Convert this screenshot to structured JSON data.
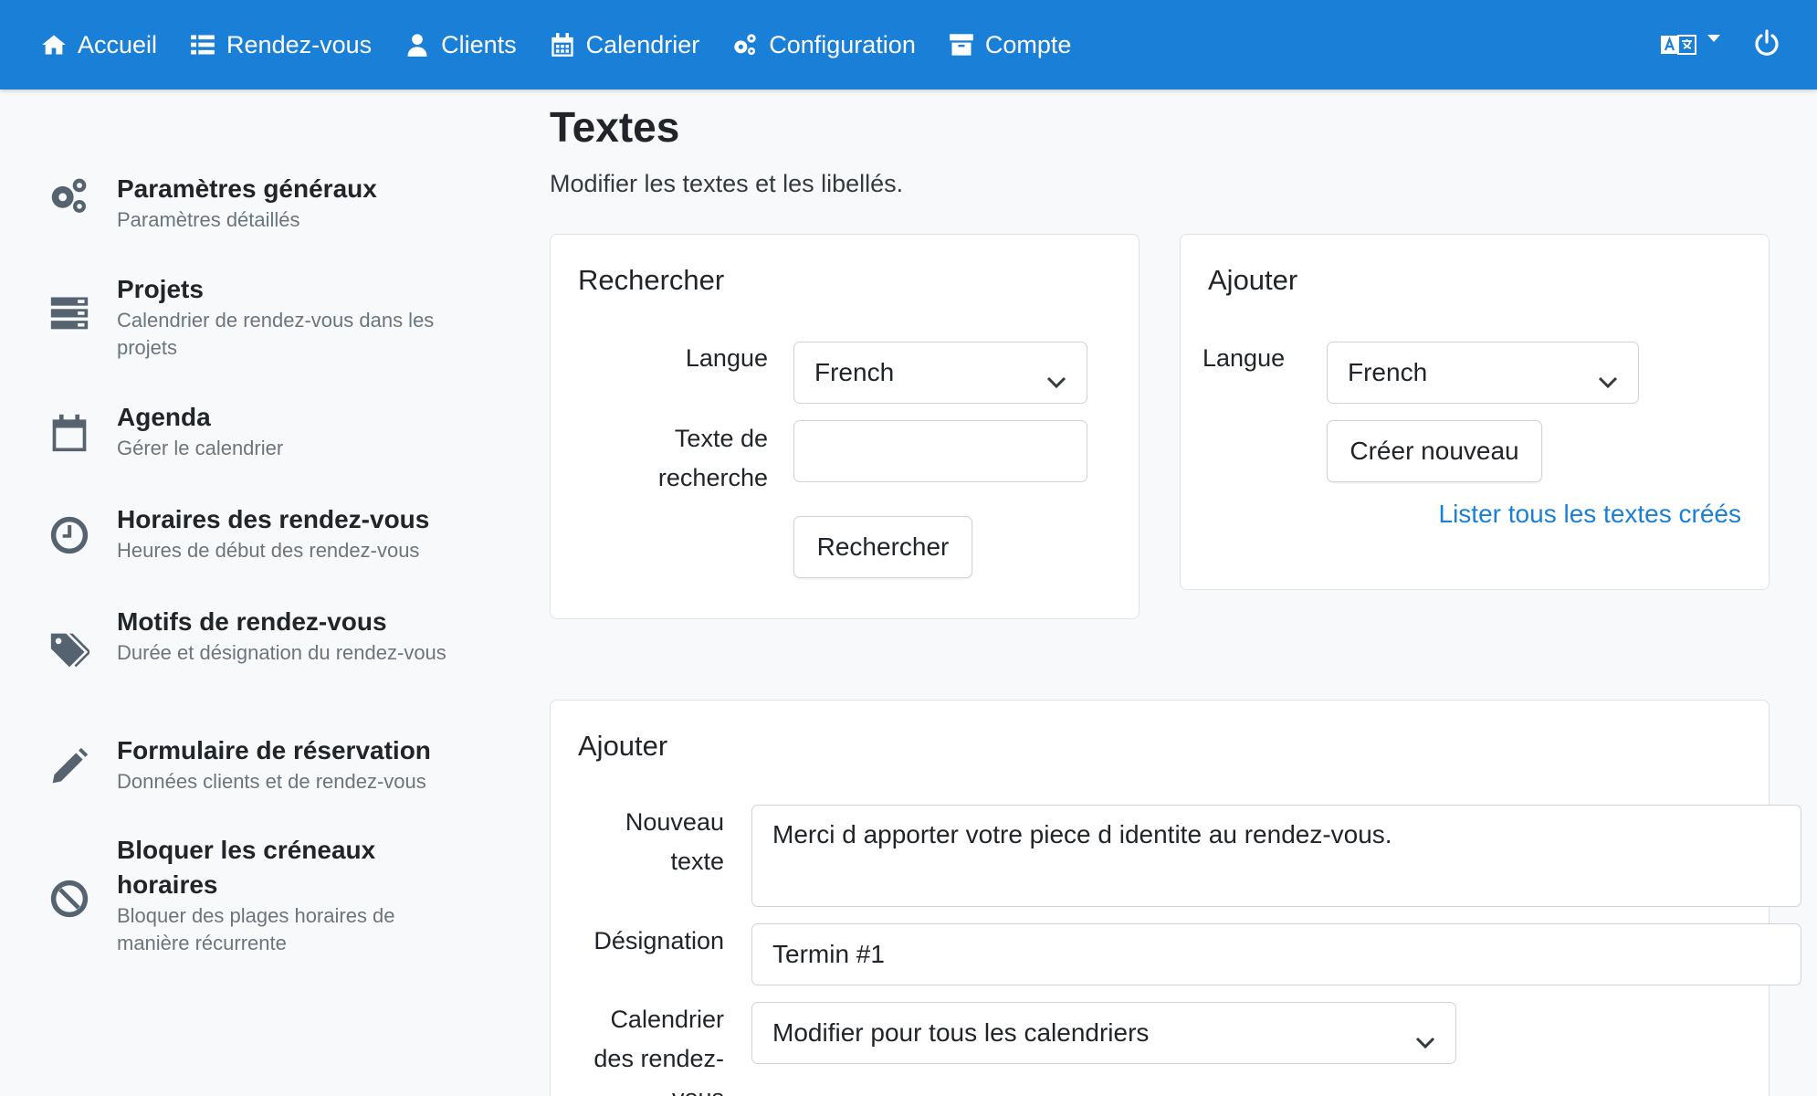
{
  "navbar": {
    "items": [
      {
        "label": "Accueil",
        "icon": "home-icon"
      },
      {
        "label": "Rendez-vous",
        "icon": "list-icon"
      },
      {
        "label": "Clients",
        "icon": "user-icon"
      },
      {
        "label": "Calendrier",
        "icon": "calendar-icon"
      },
      {
        "label": "Configuration",
        "icon": "cogs-icon"
      },
      {
        "label": "Compte",
        "icon": "archive-icon"
      }
    ],
    "right_icons": [
      "language-icon",
      "power-icon"
    ],
    "color": "#1a7fd6"
  },
  "sidebar": {
    "items": [
      {
        "title": "Paramètres généraux",
        "subtitle": "Paramètres détaillés",
        "icon": "cogs-icon"
      },
      {
        "title": "Projets",
        "subtitle": "Calendrier de rendez-vous dans les projets",
        "icon": "server-icon"
      },
      {
        "title": "Agenda",
        "subtitle": "Gérer le calendrier",
        "icon": "calendar-icon"
      },
      {
        "title": "Horaires des rendez-vous",
        "subtitle": "Heures de début des rendez-vous",
        "icon": "clock-icon"
      },
      {
        "title": "Motifs de rendez-vous",
        "subtitle": "Durée et désignation du rendez-vous",
        "icon": "tags-icon"
      },
      {
        "title": "Formulaire de réservation",
        "subtitle": "Données clients et de rendez-vous",
        "icon": "pencil-icon"
      },
      {
        "title": "Bloquer les créneaux horaires",
        "subtitle": "Bloquer des plages horaires de manière récurrente",
        "icon": "ban-icon"
      }
    ]
  },
  "main": {
    "title": "Textes",
    "subtitle": "Modifier les textes et les libellés.",
    "search_card": {
      "title": "Rechercher",
      "language_label": "Langue",
      "language_value": "French",
      "search_text_label": "Texte de recherche",
      "search_text_value": "",
      "search_button": "Rechercher"
    },
    "add_card": {
      "title": "Ajouter",
      "language_label": "Langue",
      "language_value": "French",
      "create_button": "Créer nouveau",
      "list_link": "Lister tous les textes créés"
    },
    "add_form": {
      "title": "Ajouter",
      "new_text_label": "Nouveau texte",
      "new_text_value": "Merci d apporter votre piece d identite au rendez-vous.",
      "designation_label": "Désignation",
      "designation_value": "Termin #1",
      "calendar_label": "Calendrier des rendez-vous",
      "calendar_value": "Modifier pour tous les calendriers"
    }
  }
}
